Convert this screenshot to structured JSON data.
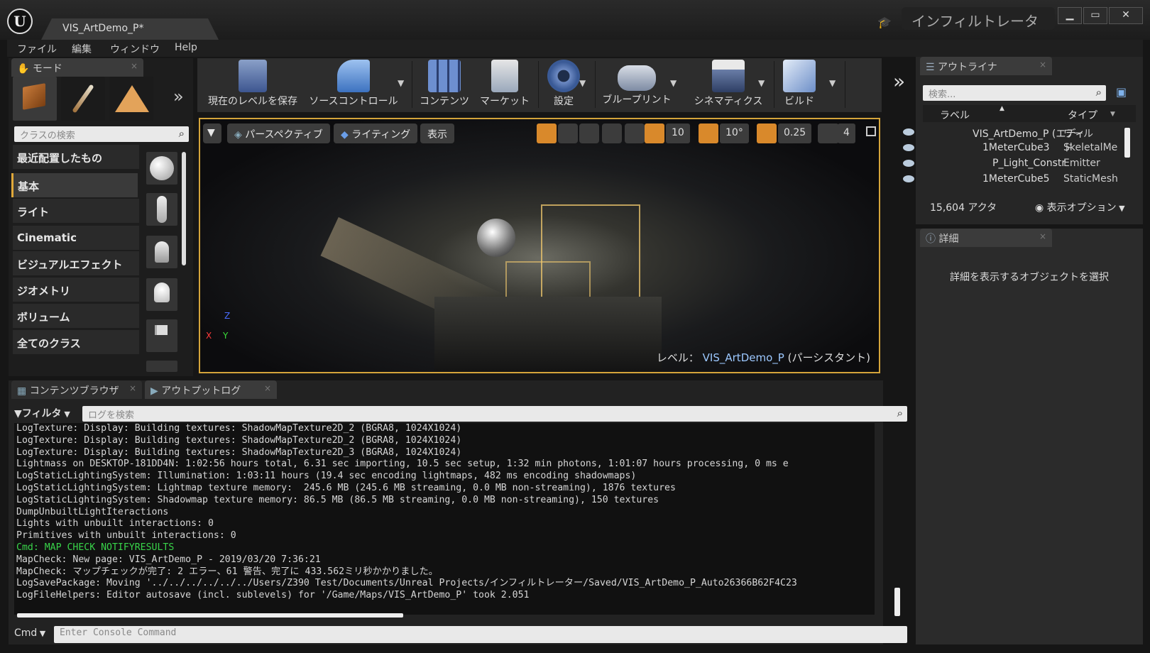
{
  "window": {
    "doc_tab": "VIS_ArtDemo_P*",
    "project_name": "インフィルトレーター",
    "btn_min": "▁",
    "btn_max": "▭",
    "btn_close": "✕"
  },
  "menu": {
    "file": "ファイル",
    "edit": "編集",
    "window": "ウィンドウ",
    "help": "Help"
  },
  "modes": {
    "tab": "モード",
    "search_placeholder": "クラスの検索",
    "categories": [
      "最近配置したもの",
      "基本",
      "ライト",
      "Cinematic",
      "ビジュアルエフェクト",
      "ジオメトリ",
      "ボリューム",
      "全てのクラス"
    ],
    "more": "»"
  },
  "toolbar": {
    "save": "現在のレベルを保存",
    "source_control": "ソースコントロール",
    "content": "コンテンツ",
    "market": "マーケット",
    "settings": "設定",
    "blueprint": "ブループリント",
    "cinematics": "シネマティクス",
    "build": "ビルド",
    "more": "»"
  },
  "viewport": {
    "perspective": "パースペクティブ",
    "lighting": "ライティング",
    "show": "表示",
    "grid_snap": "10",
    "rot_snap": "10°",
    "scale_snap": "0.25",
    "cam_speed": "4",
    "level_prefix": "レベル：",
    "level_name": "VIS_ArtDemo_P",
    "level_suffix": "(パーシスタント)",
    "axis_z": "Z",
    "axis_x": "X",
    "axis_y": "Y"
  },
  "bottom": {
    "tab_content": "コンテンツブラウザ",
    "tab_output": "アウトプットログ",
    "filter": "フィルタ",
    "log_search_placeholder": "ログを検索",
    "cmd": "Cmd",
    "cmd_placeholder": "Enter Console Command",
    "log_lines": [
      "LogTexture: Display: Building textures: ShadowMapTexture2D_2 (BGRA8, 1024X1024)",
      "LogTexture: Display: Building textures: ShadowMapTexture2D_2 (BGRA8, 1024X1024)",
      "LogTexture: Display: Building textures: ShadowMapTexture2D_3 (BGRA8, 1024X1024)",
      "Lightmass on DESKTOP-181DD4N: 1:02:56 hours total, 6.31 sec importing, 10.5 sec setup, 1:32 min photons, 1:01:07 hours processing, 0 ms e",
      "LogStaticLightingSystem: Illumination: 1:03:11 hours (19.4 sec encoding lightmaps, 482 ms encoding shadowmaps)",
      "LogStaticLightingSystem: Lightmap texture memory:  245.6 MB (245.6 MB streaming, 0.0 MB non-streaming), 1876 textures",
      "LogStaticLightingSystem: Shadowmap texture memory: 86.5 MB (86.5 MB streaming, 0.0 MB non-streaming), 150 textures",
      "DumpUnbuiltLightIteractions",
      "Lights with unbuilt interactions: 0",
      "Primitives with unbuilt interactions: 0",
      "Cmd: MAP CHECK NOTIFYRESULTS",
      "MapCheck: New page: VIS_ArtDemo_P - 2019/03/20 7:36:21",
      "MapCheck: マップチェックが完了: 2 エラー、61 警告、完了に 433.562ミリ秒かかりました。",
      "LogSavePackage: Moving '../../../../../../Users/Z390 Test/Documents/Unreal Projects/インフィルトレーター/Saved/VIS_ArtDemo_P_Auto26366B62F4C23",
      "LogFileHelpers: Editor autosave (incl. sublevels) for '/Game/Maps/VIS_ArtDemo_P' took 2.051"
    ]
  },
  "outliner": {
    "tab": "アウトライナ",
    "search_placeholder": "検索...",
    "col_label": "ラベル",
    "col_type": "タイプ",
    "rows": [
      {
        "label": "VIS_ArtDemo_P (エディ",
        "type": "ワールド"
      },
      {
        "label": "1MeterCube3",
        "type": "SkeletalMe"
      },
      {
        "label": "P_Light_Constr",
        "type": "Emitter"
      },
      {
        "label": "1MeterCube5",
        "type": "StaticMesh"
      }
    ],
    "actor_count": "15,604 アクタ",
    "view_options": "表示オプション"
  },
  "details": {
    "tab": "詳細",
    "empty_message": "詳細を表示するオブジェクトを選択"
  },
  "colors": {
    "accent": "#d4a43a",
    "log_green": "#39d44a",
    "level_blue": "#9cc8ff"
  }
}
